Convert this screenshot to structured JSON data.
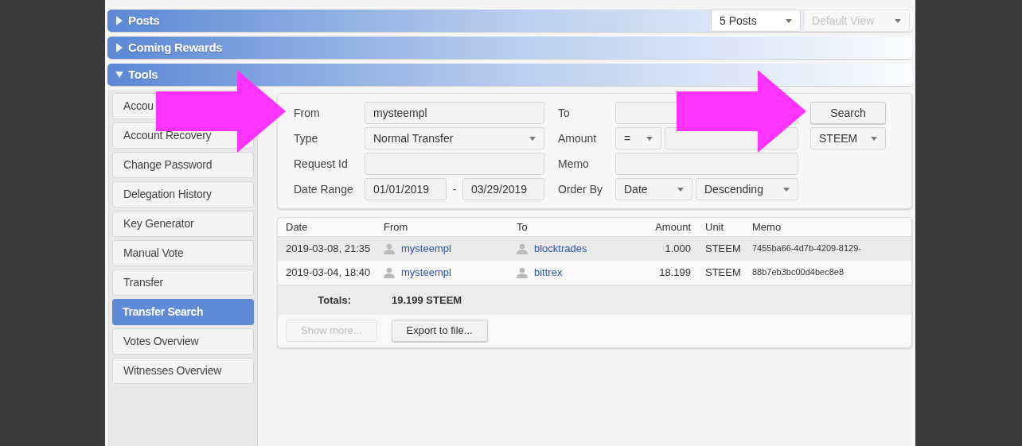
{
  "sections": [
    {
      "title": "Posts",
      "expanded": false,
      "controls": [
        {
          "value": "5 Posts",
          "disabled": false
        },
        {
          "value": "Default View",
          "disabled": true
        }
      ]
    },
    {
      "title": "Coming Rewards",
      "expanded": false
    },
    {
      "title": "Tools",
      "expanded": true
    }
  ],
  "tools_menu": [
    {
      "label": "Accou",
      "selected": false
    },
    {
      "label": "Account Recovery",
      "selected": false
    },
    {
      "label": "Change Password",
      "selected": false
    },
    {
      "label": "Delegation History",
      "selected": false
    },
    {
      "label": "Key Generator",
      "selected": false
    },
    {
      "label": "Manual Vote",
      "selected": false
    },
    {
      "label": "Transfer",
      "selected": false
    },
    {
      "label": "Transfer Search",
      "selected": true
    },
    {
      "label": "Votes Overview",
      "selected": false
    },
    {
      "label": "Witnesses Overview",
      "selected": false
    }
  ],
  "search_form": {
    "from": {
      "label": "From",
      "value": "mysteempl"
    },
    "to": {
      "label": "To"
    },
    "type": {
      "label": "Type",
      "value": "Normal Transfer"
    },
    "amount": {
      "label": "Amount",
      "operator": "="
    },
    "request_id": {
      "label": "Request Id"
    },
    "memo": {
      "label": "Memo"
    },
    "date_range": {
      "label": "Date Range",
      "start": "01/01/2019",
      "separator": "-",
      "end": "03/29/2019"
    },
    "order_by": {
      "label": "Order By",
      "field": "Date",
      "direction": "Descending"
    },
    "search_button": "Search",
    "currency": "STEEM"
  },
  "results": {
    "columns": [
      "Date",
      "From",
      "To",
      "Amount",
      "Unit",
      "Memo"
    ],
    "rows": [
      {
        "date": "2019-03-08, 21:35",
        "from": "mysteempl",
        "to": "blocktrades",
        "amount": "1.000",
        "unit": "STEEM",
        "memo": "7455ba66-4d7b-4209-8129-",
        "selected": true
      },
      {
        "date": "2019-03-04, 18:40",
        "from": "mysteempl",
        "to": "bittrex",
        "amount": "18.199",
        "unit": "STEEM",
        "memo": "88b7eb3bc00d4bec8e8",
        "selected": false
      }
    ],
    "totals": {
      "label": "Totals:",
      "value": "19.199 STEEM"
    },
    "buttons": [
      {
        "label": "Show more...",
        "disabled": true
      },
      {
        "label": "Export to file...",
        "disabled": false
      }
    ]
  }
}
